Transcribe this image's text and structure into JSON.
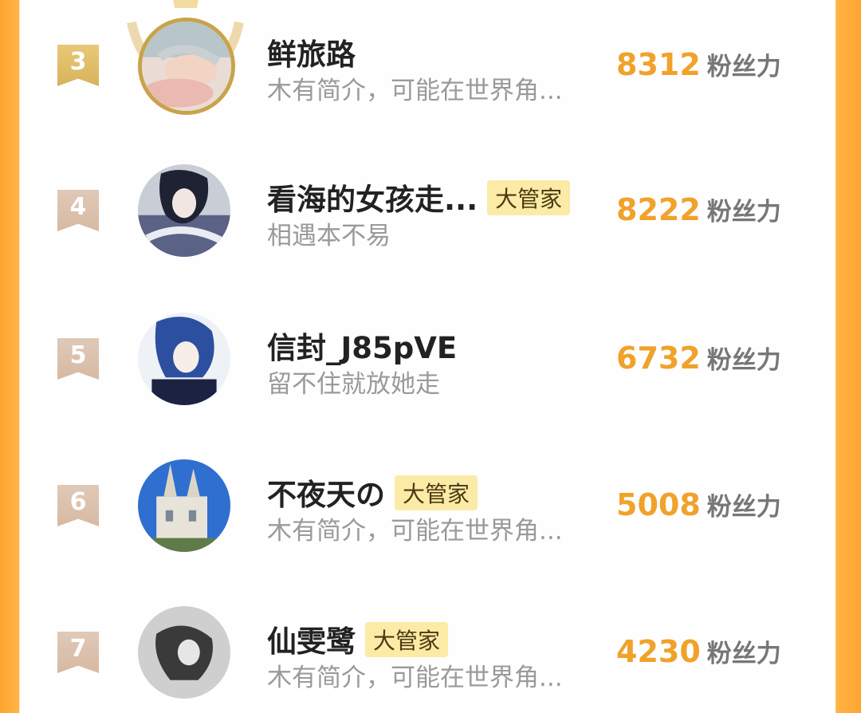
{
  "fans": [
    {
      "rank": "3",
      "name": "鲜旅路",
      "badge": "",
      "bio": "木有简介，可能在世界角...",
      "score": "8312",
      "unit": "粉丝力",
      "avatar_icon": "avatar-girl-lying-icon"
    },
    {
      "rank": "4",
      "name": "看海的女孩走...",
      "badge": "大管家",
      "bio": "相遇本不易",
      "score": "8222",
      "unit": "粉丝力",
      "avatar_icon": "avatar-anime-boy-icon"
    },
    {
      "rank": "5",
      "name": "信封_J85pVE",
      "badge": "",
      "bio": "留不住就放她走",
      "score": "6732",
      "unit": "粉丝力",
      "avatar_icon": "avatar-blue-hair-icon"
    },
    {
      "rank": "6",
      "name": "不夜天の",
      "badge": "大管家",
      "bio": "木有简介，可能在世界角...",
      "score": "5008",
      "unit": "粉丝力",
      "avatar_icon": "avatar-church-icon"
    },
    {
      "rank": "7",
      "name": "仙雯鹭",
      "badge": "大管家",
      "bio": "木有简介，可能在世界角...",
      "score": "4230",
      "unit": "粉丝力",
      "avatar_icon": "avatar-bw-portrait-icon"
    }
  ],
  "colors": {
    "accent": "#f0a22a",
    "badge_bg": "#fbeba6",
    "side": "#ffa42f"
  }
}
